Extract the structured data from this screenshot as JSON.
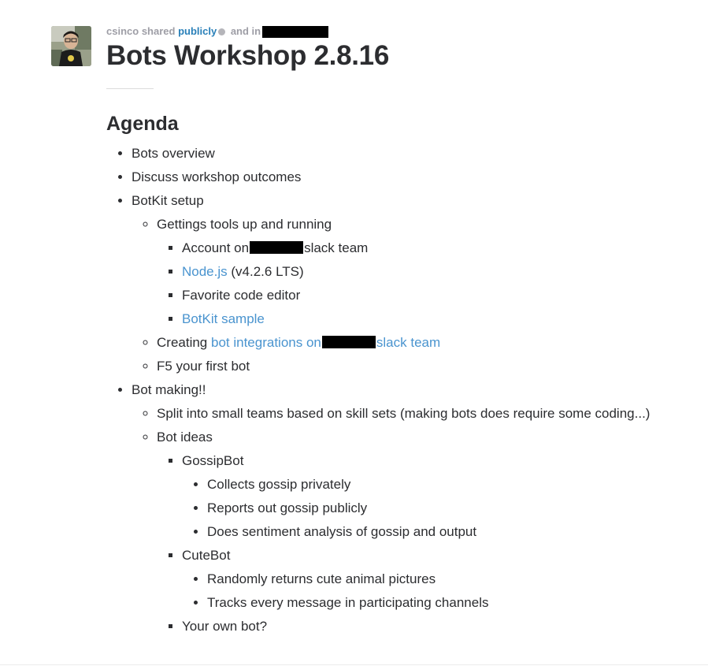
{
  "header": {
    "author": "csinco",
    "shared_text": "shared",
    "visibility": "publicly",
    "and_in": "and in",
    "title": "Bots Workshop 2.8.16"
  },
  "post": {
    "heading": "Agenda",
    "items": {
      "overview": "Bots overview",
      "outcomes": "Discuss workshop outcomes",
      "setup": "BotKit setup",
      "tools": "Gettings tools up and running",
      "account_pre": "Account on",
      "account_post": "slack team",
      "nodejs_link": "Node.js",
      "nodejs_version": "(v4.2.6 LTS)",
      "editor": "Favorite code editor",
      "botkit_sample": "BotKit sample",
      "creating_pre": "Creating",
      "creating_link_pre": "bot integrations on",
      "creating_link_post": "slack team",
      "f5": "F5 your first bot",
      "making": "Bot making!!",
      "split": "Split into small teams based on skill sets (making bots does require some coding...)",
      "ideas": "Bot ideas",
      "gossipbot": "GossipBot",
      "gossip_1": "Collects gossip privately",
      "gossip_2": "Reports out gossip publicly",
      "gossip_3": "Does sentiment analysis of gossip and output",
      "cutebot": "CuteBot",
      "cute_1": "Randomly returns cute animal pictures",
      "cute_2": "Tracks every message in participating channels",
      "own_bot": "Your own bot?"
    }
  },
  "colors": {
    "link": "#4a94cf",
    "meta_link": "#2a80b9",
    "text": "#2c2d30",
    "meta_text": "#9e9ea6"
  }
}
